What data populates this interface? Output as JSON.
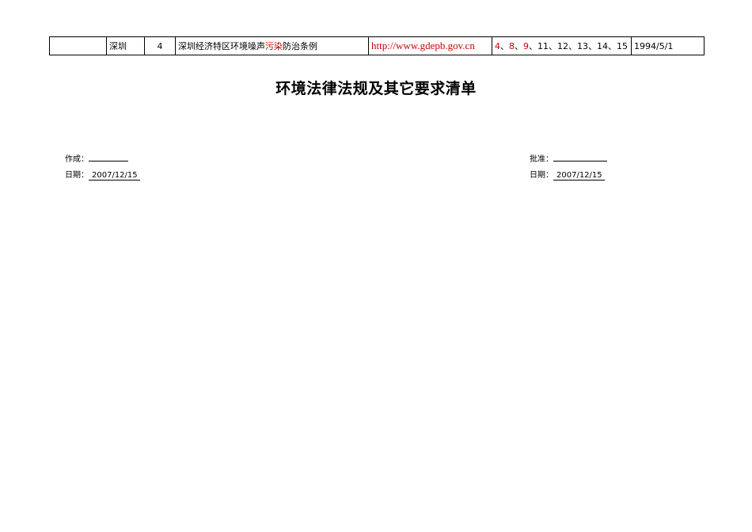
{
  "table_row": {
    "col1": "",
    "city": "深圳",
    "number": "4",
    "name_parts": [
      "深圳经济特区环境噪声",
      "污染",
      "防治条例"
    ],
    "url": "http://www.gdepb.gov.cn",
    "clauses_red": [
      "4",
      "8",
      "9"
    ],
    "clause_sep": "、",
    "clauses_rest": "11、12、13、14、15",
    "date": "1994/5/1"
  },
  "title": "环境法律法规及其它要求清单",
  "left": {
    "author_label": "作成：",
    "date_label": "日期：",
    "date_value": "2007/12/15"
  },
  "right": {
    "approve_label": "批准：",
    "date_label": "日期：",
    "date_value": "2007/12/15"
  },
  "colors": {
    "highlight": "#cc0000"
  }
}
